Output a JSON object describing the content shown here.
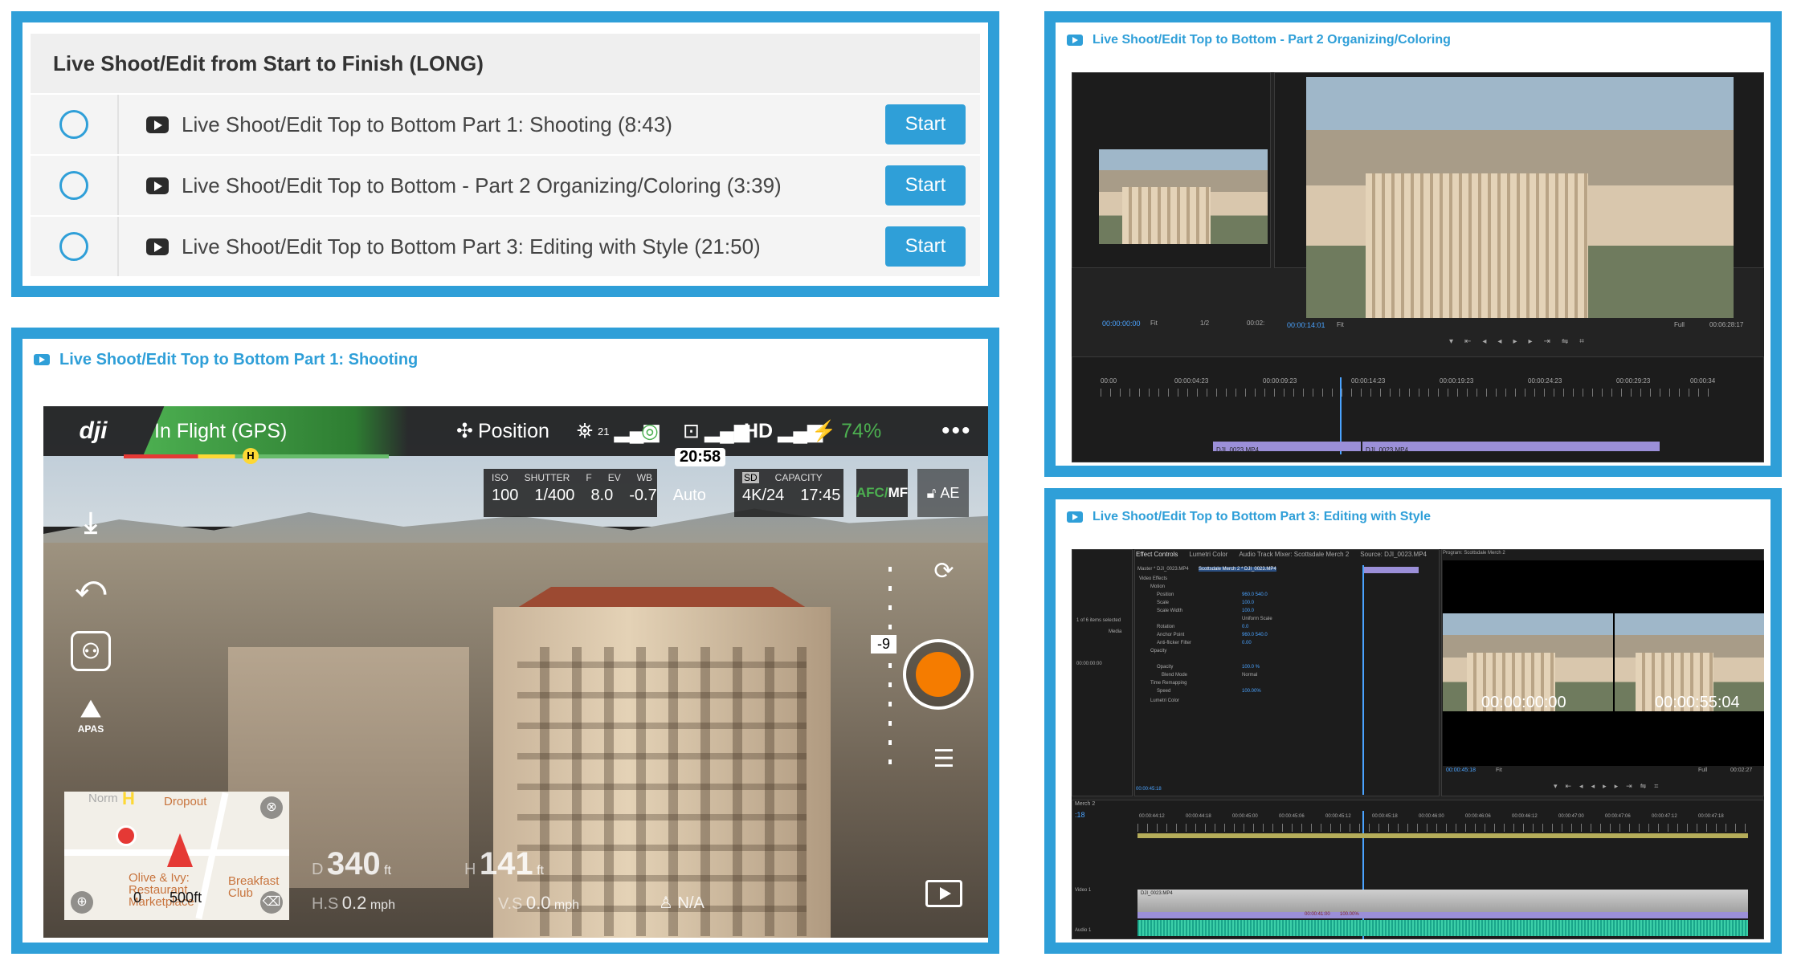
{
  "course": {
    "title": "Live Shoot/Edit from Start to Finish (LONG)",
    "lessons": [
      {
        "title": "Live Shoot/Edit Top to Bottom Part 1: Shooting (8:43)",
        "button": "Start"
      },
      {
        "title": "Live Shoot/Edit Top to Bottom - Part 2 Organizing/Coloring (3:39)",
        "button": "Start"
      },
      {
        "title": "Live Shoot/Edit Top to Bottom Part 3: Editing with Style (21:50)",
        "button": "Start"
      }
    ]
  },
  "video1": {
    "title": "Live Shoot/Edit Top to Bottom Part 1: Shooting",
    "dji": {
      "logo": "dji",
      "flight_status": "In Flight (GPS)",
      "home_marker": "H",
      "mode": "Position",
      "satellites": "21",
      "hd_label": "HD",
      "battery": "74%",
      "more": "•••",
      "timer": "20:58",
      "camera": {
        "iso_label": "ISO",
        "iso": "100",
        "shutter_label": "SHUTTER",
        "shutter": "1/400",
        "f_label": "F",
        "f": "8.0",
        "ev_label": "EV",
        "ev": "-0.7",
        "wb_label": "WB",
        "wb": "Auto"
      },
      "storage": {
        "sd_label": "SD",
        "capacity_label": "CAPACITY",
        "format": "4K/24",
        "capacity": "17:45"
      },
      "focus_mode_a": "AFC/",
      "focus_mode_b": "MF",
      "ae": "AE",
      "ev_scale": "-9",
      "apas": "APAS",
      "map": {
        "home": "H",
        "label_dropout": "Dropout",
        "label_restaurant": "Olive & Ivy: Restaurant Marketplace",
        "label_breakfast": "Breakfast Club",
        "label_norm": "Norm",
        "scale_zero": "0",
        "scale_dist": "500ft"
      },
      "distance_prefix": "D",
      "distance": "340",
      "distance_unit": "ft",
      "height_prefix": "H",
      "height": "141",
      "height_unit": "ft",
      "hspeed_prefix": "H.S",
      "hspeed": "0.2",
      "hspeed_unit": "mph",
      "vspeed_prefix": "V.S",
      "vspeed": "0.0",
      "vspeed_unit": "mph",
      "vps": "N/A"
    }
  },
  "video2": {
    "title": "Live Shoot/Edit Top to Bottom - Part 2 Organizing/Coloring",
    "source_tc": "00:00:00:00",
    "source_end_tc": "00:02:",
    "program_tc": "00:00:14:01",
    "program_end_tc": "00:06:28:17",
    "timeline_start": "00:00",
    "ruler_marks": [
      "00:00:04:23",
      "00:00:09:23",
      "00:00:14:23",
      "00:00:19:23",
      "00:00:24:23",
      "00:00:29:23",
      "00:00:34"
    ],
    "fit_a": "Fit",
    "fit_b": "Fit",
    "full": "Full",
    "ratio": "1/2",
    "clip_a": "DJI_0023.MP4",
    "clip_b": "DJI_0023.MP4"
  },
  "video3": {
    "title": "Live Shoot/Edit Top to Bottom Part 3: Editing with Style",
    "tabs": [
      "Effect Controls",
      "Lumetri Color",
      "Audio Track Mixer: Scottsdale Merch 2",
      "Source: DJI_0023.MP4"
    ],
    "master": "Master * DJI_0023.MP4",
    "sequence": "Scottsdale Merch 2 * DJI_0023.MP4",
    "program_tab": "Program: Scottsdale Merch 2",
    "effects": [
      "Video Effects",
      "Motion",
      "Position",
      "Scale",
      "Scale Width",
      "Uniform Scale",
      "Rotation",
      "Anchor Point",
      "Anti-flicker Filter",
      "Opacity",
      "Opacity",
      "Blend Mode",
      "Time Remapping",
      "Speed",
      "Lumetri Color"
    ],
    "values": [
      "960.0  540.0",
      "100.0",
      "100.0",
      "0.0",
      "960.0  540.0",
      "0.00",
      "100.0 %",
      "Normal",
      "100.00%"
    ],
    "tc_left": "00:00:00:00",
    "tc_right": "00:00:55:04",
    "program_tc": "00:00:45:18",
    "program_end_tc": "00:02:27",
    "fit": "Fit",
    "full": "Full",
    "timeline_tc": ":18",
    "seq_name": "Merch 2",
    "effect_tc": "00:00:45:18",
    "clip_tc": "00:00:41:00",
    "speed": "100.00%",
    "clip_name": "DJI_0023.MP4",
    "items_sel": "1 of 6 items selected",
    "bin_label": "Media",
    "bin_tc": "00:00:00:00",
    "ruler_marks": [
      "00:00:44:12",
      "00:00:44:18",
      "00:00:45:00",
      "00:00:45:06",
      "00:00:45:12",
      "00:00:45:18",
      "00:00:46:00",
      "00:00:46:06",
      "00:00:46:12",
      "00:00:47:00",
      "00:00:47:06",
      "00:00:47:12",
      "00:00:47:18"
    ],
    "track_v1": "Video 1",
    "track_a1": "Audio 1"
  }
}
